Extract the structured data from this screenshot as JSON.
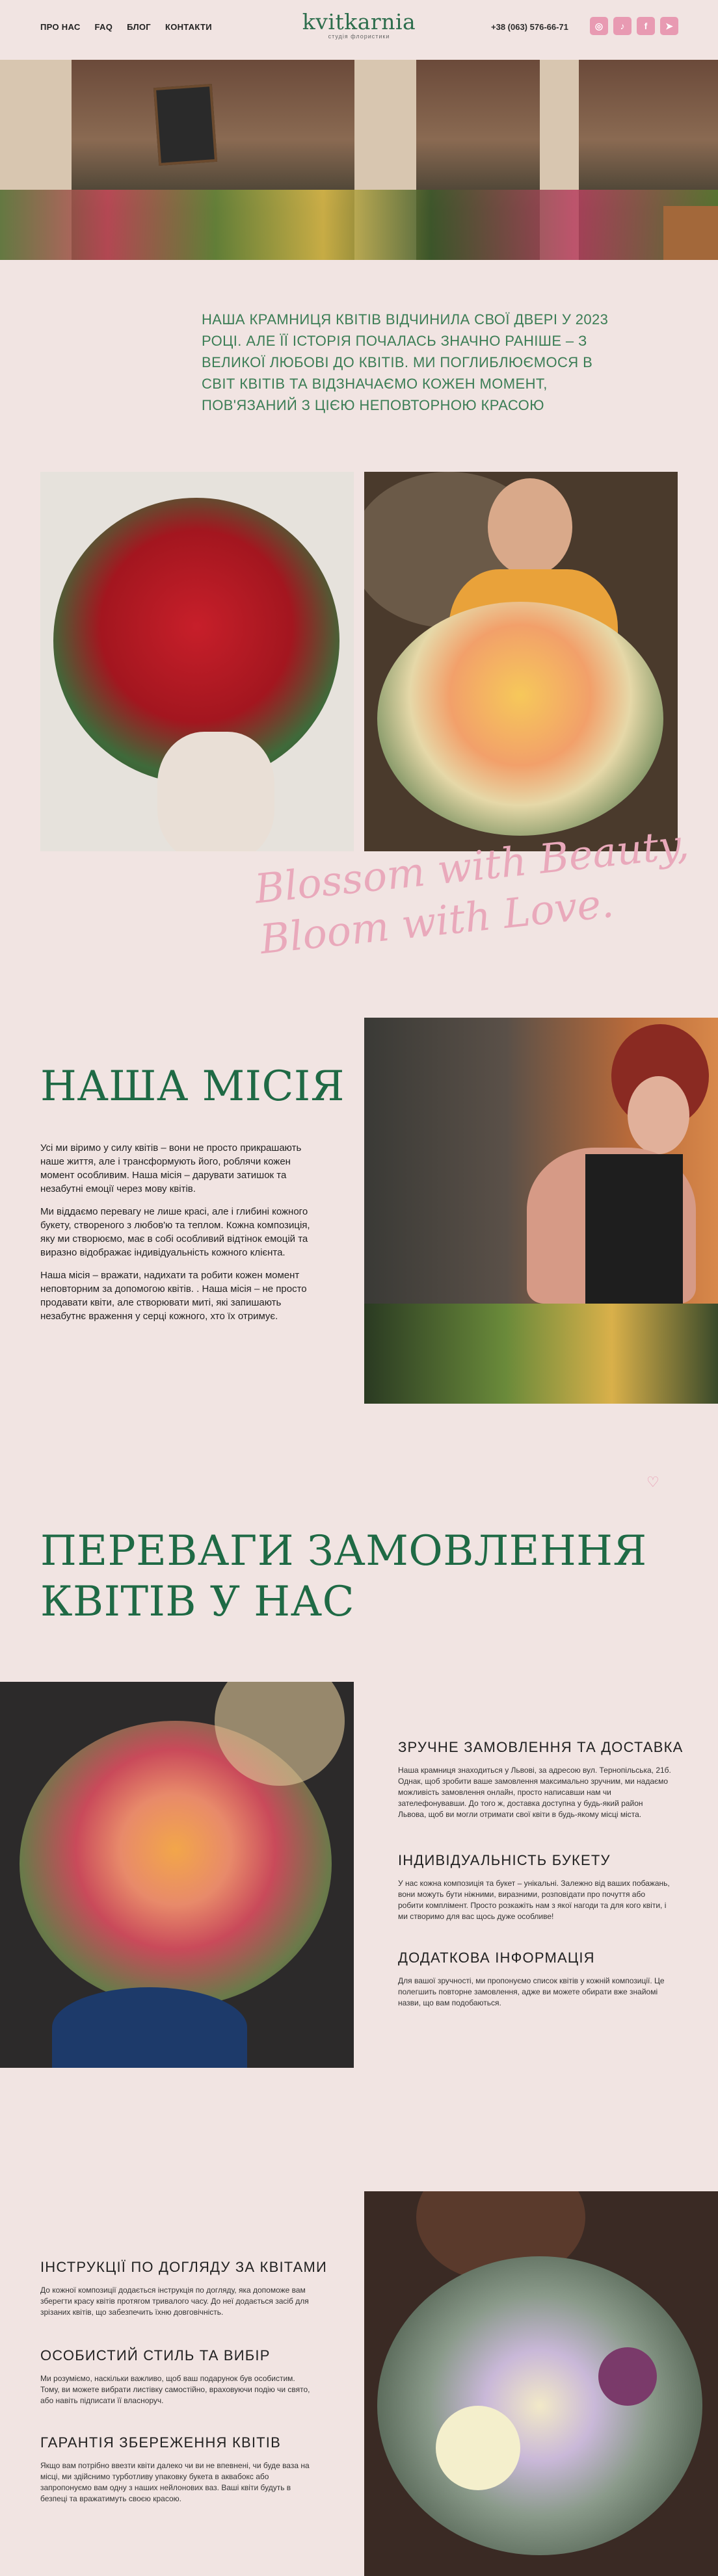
{
  "header": {
    "nav": [
      "ПРО НАС",
      "FAQ",
      "БЛОГ",
      "КОНТАКТИ"
    ],
    "logo_name": "kvitkarnia",
    "logo_sub": "студія флористики",
    "phone": "+38 (063) 576-66-71",
    "social": [
      {
        "name": "instagram",
        "glyph": "◎"
      },
      {
        "name": "tiktok",
        "glyph": "♪"
      },
      {
        "name": "facebook",
        "glyph": "f"
      },
      {
        "name": "telegram",
        "glyph": "➤"
      }
    ]
  },
  "intro_text": "Наша крамниця квітів відчинила свої двері у 2023 році. Але її історія почалась значно раніше – з великої любові до квітів. Ми поглиблюємося в світ квітів та відзначаємо кожен момент, пов'язаний з цією неповторною красою",
  "script_line1": "Blossom with Beauty,",
  "script_line2": "Bloom with Love.",
  "mission": {
    "title": "НАША МІСІЯ",
    "p1": "Усі ми віримо у силу квітів – вони не просто прикрашають наше життя, але і трансформують його, роблячи кожен момент особливим. Наша місія – дарувати затишок та незабутні емоції через мову квітів.",
    "p2": "Ми віддаємо перевагу не лише красі, але і глибині кожного букету, створеного з любов'ю та теплом. Кожна композиція, яку ми створюємо, має в собі особливий відтінок емоцій та виразно відображає індивідуальність кожного клієнта.",
    "p3": "Наша місія – вражати, надихати та робити кожен момент неповторним за допомогою квітів. . Наша місія – не просто продавати квіти, але створювати миті, які запишають незабутнє враження у серці кожного, хто їх отримує."
  },
  "advantages": {
    "title_line1": "ПЕРЕВАГИ ЗАМОВЛЕННЯ",
    "title_line2": "КВІТІВ У НАС",
    "items": [
      {
        "title": "ЗРУЧНЕ ЗАМОВЛЕННЯ ТА ДОСТАВКА",
        "text": "Наша крамниця знаходиться у Львові, за адресою вул. Тернопільська, 21б. Однак, щоб зробити ваше замовлення максимально зручним, ми надаємо можливість замовлення онлайн, просто написавши нам чи зателефонувавши. До того ж, доставка доступна у будь-який район Львова, щоб ви могли отримати свої квіти в будь-якому місці міста."
      },
      {
        "title": "ІНДИВІДУАЛЬНІСТЬ БУКЕТУ",
        "text": "У нас кожна композиція та букет – унікальні. Залежно від ваших побажань, вони можуть бути ніжними, виразними, розповідати про почуття або робити комплімент. Просто розкажіть нам з якої нагоди та для кого квіти, і ми створимо для вас щось дуже особливе!"
      },
      {
        "title": "ДОДАТКОВА ІНФОРМАЦІЯ",
        "text": "Для вашої зручності, ми пропонуємо список квітів у кожній композиції. Це полегшить повторне замовлення, адже ви можете обирати вже знайомі назви, що вам подобаються."
      }
    ]
  },
  "care": {
    "items": [
      {
        "title": "ІНСТРУКЦІЇ ПО ДОГЛЯДУ ЗА КВІТАМИ",
        "text": "До кожної композиції додається інструкція по догляду, яка допоможе вам зберегти красу квітів протягом тривалого часу. До неї додається засіб для зрізаних квітів, що забезпечить їхню довговічність."
      },
      {
        "title": "ОСОБИСТИЙ СТИЛЬ ТА ВИБІР",
        "text": "Ми розуміємо, наскільки важливо, щоб ваш подарунок був особистим. Тому, ви можете вибрати листівку самостійно, враховуючи подію чи свято, або навіть підписати її власноруч."
      },
      {
        "title": "ГАРАНТІЯ ЗБЕРЕЖЕННЯ КВІТІВ",
        "text": "Якщо вам потрібно ввезти квіти далеко чи ви не впевнені, чи буде ваза на місці, ми здійснимо турботливу упаковку букета в аквабокс або запропонуємо вам одну з наших нейлонових ваз. Ваші квіти будуть в безпеці та вражатимуть своєю красою."
      }
    ]
  },
  "colors": {
    "accent_green": "#1f6a45",
    "pink": "#e89ab2",
    "background": "#f1e4e2"
  }
}
